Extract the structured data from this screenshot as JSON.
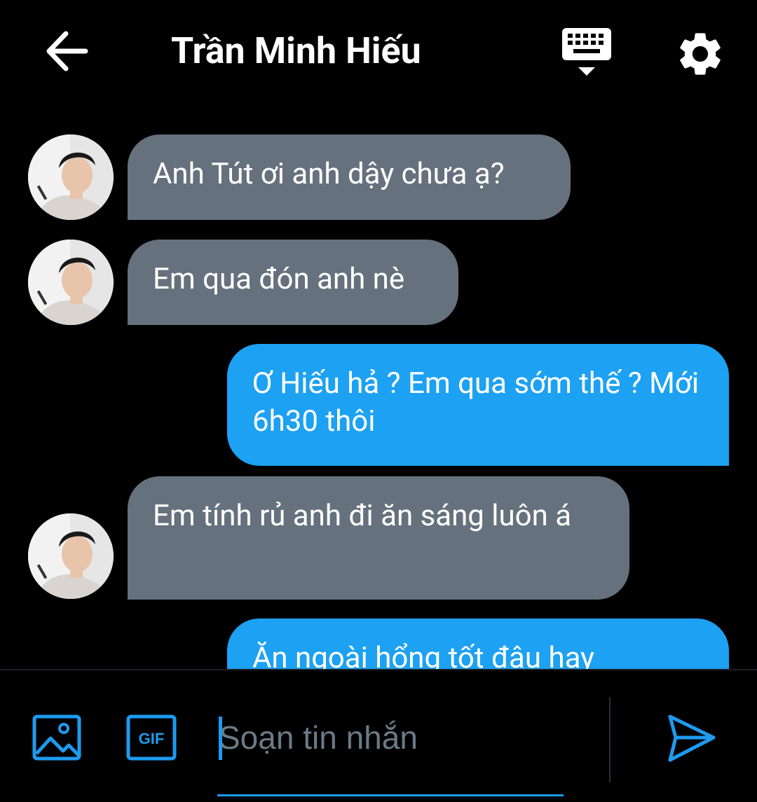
{
  "header": {
    "title": "Trần Minh Hiếu"
  },
  "icons": {
    "back": "arrow-left-icon",
    "keyboard": "keyboard-icon",
    "settings": "gear-icon",
    "image": "image-icon",
    "gif": "gif-icon",
    "send": "send-icon"
  },
  "messages": [
    {
      "direction": "in",
      "text": "Anh Tút ơi anh dậy chưa ạ?"
    },
    {
      "direction": "in",
      "text": "Em qua đón anh nè"
    },
    {
      "direction": "out",
      "text": "Ơ Hiếu hả ? Em qua sớm thế ? Mới 6h30 thôi"
    },
    {
      "direction": "in",
      "text": "Em tính rủ anh đi ăn sáng luôn á"
    },
    {
      "direction": "out",
      "text": "Ăn ngoài hổng tốt đâu hay"
    }
  ],
  "composer": {
    "placeholder": "Soạn tin nhắn",
    "gif_label": "GIF"
  },
  "colors": {
    "incoming_bubble": "#66717e",
    "outgoing_bubble": "#1da1f2",
    "accent": "#1d9bf0",
    "background": "#000000"
  }
}
